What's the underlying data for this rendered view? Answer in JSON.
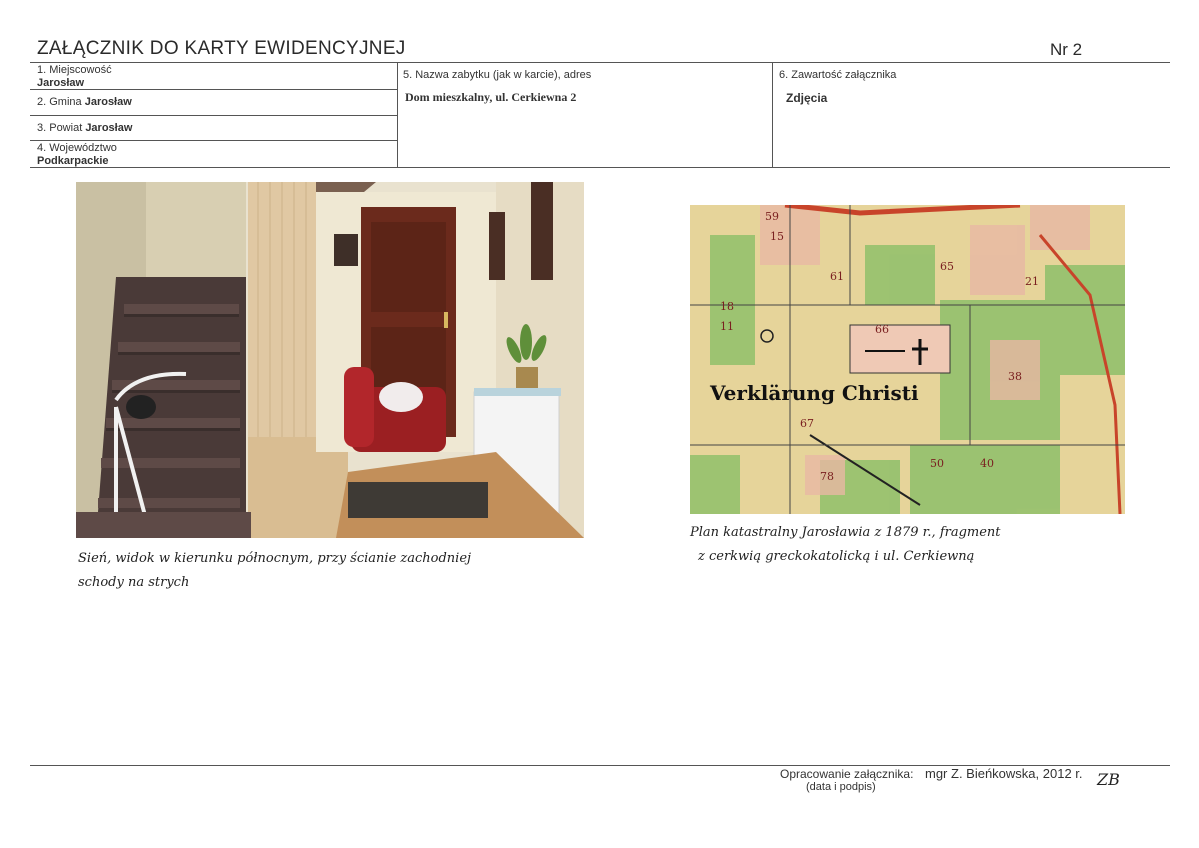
{
  "header": {
    "title": "ZAŁĄCZNIK DO KARTY EWIDENCYJNEJ",
    "number": "Nr 2"
  },
  "fields": {
    "miejscowosc_label": "1. Miejscowość",
    "miejscowosc_value": "Jarosław",
    "gmina_label": "2. Gmina",
    "gmina_value": "Jarosław",
    "powiat_label": "3. Powiat",
    "powiat_value": "Jarosław",
    "wojewodztwo_label": "4. Województwo",
    "wojewodztwo_value": "Podkarpackie",
    "nazwa_label": "5. Nazwa zabytku (jak w karcie), adres",
    "nazwa_value": "Dom mieszkalny, ul. Cerkiewna 2",
    "zawartosc_label": "6. Zawartość załącznika",
    "zawartosc_value": "Zdjęcia"
  },
  "captions": {
    "photo_line1": "Sień, widok w kierunku północnym, przy ścianie zachodniej",
    "photo_line2": "schody na strych",
    "map_line1": "Plan katastralny Jarosławia z 1879 r., fragment",
    "map_line2": "z cerkwią greckokatolicką i ul. Cerkiewną",
    "map_label": "Verklärung Christi"
  },
  "map_parcels": [
    "15",
    "59",
    "61",
    "65",
    "21",
    "66",
    "67",
    "78",
    "50",
    "40",
    "38",
    "18",
    "11"
  ],
  "footer": {
    "label": "Opracowanie załącznika:",
    "sublabel": "(data i podpis)",
    "author": "mgr Z. Bieńkowska, 2012 r.",
    "signature": "ZB"
  },
  "colors": {
    "map_paper": "#e6d49a",
    "map_green": "#8fbf6a",
    "map_red": "#c8442a"
  }
}
